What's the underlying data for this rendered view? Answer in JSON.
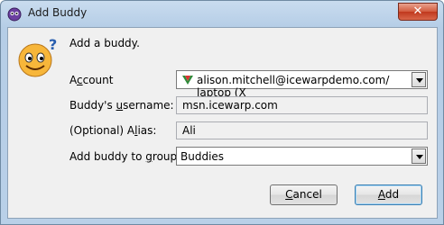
{
  "window": {
    "title": "Add Buddy",
    "close_label": "✕"
  },
  "heading": "Add a buddy.",
  "fields": {
    "account": {
      "label_pre": "A",
      "label_u": "c",
      "label_post": "count",
      "value": "alison.mitchell@icewarpdemo.com/ laptop (X"
    },
    "username": {
      "label_pre": "Buddy's ",
      "label_u": "u",
      "label_post": "sername:",
      "value": "msn.icewarp.com"
    },
    "alias": {
      "label_pre": "(Optional) A",
      "label_u": "l",
      "label_post": "ias:",
      "value": "Ali"
    },
    "group": {
      "label_pre": "Add buddy to ",
      "label_u": "g",
      "label_post": "roup:",
      "value": "Buddies"
    }
  },
  "buttons": {
    "cancel": {
      "u": "C",
      "rest": "ancel"
    },
    "add": {
      "u": "A",
      "rest": "dd"
    }
  },
  "icons": {
    "app": "pidgin-icon",
    "buddy": "smiley-question-icon",
    "account": "msn-butterfly-icon"
  }
}
